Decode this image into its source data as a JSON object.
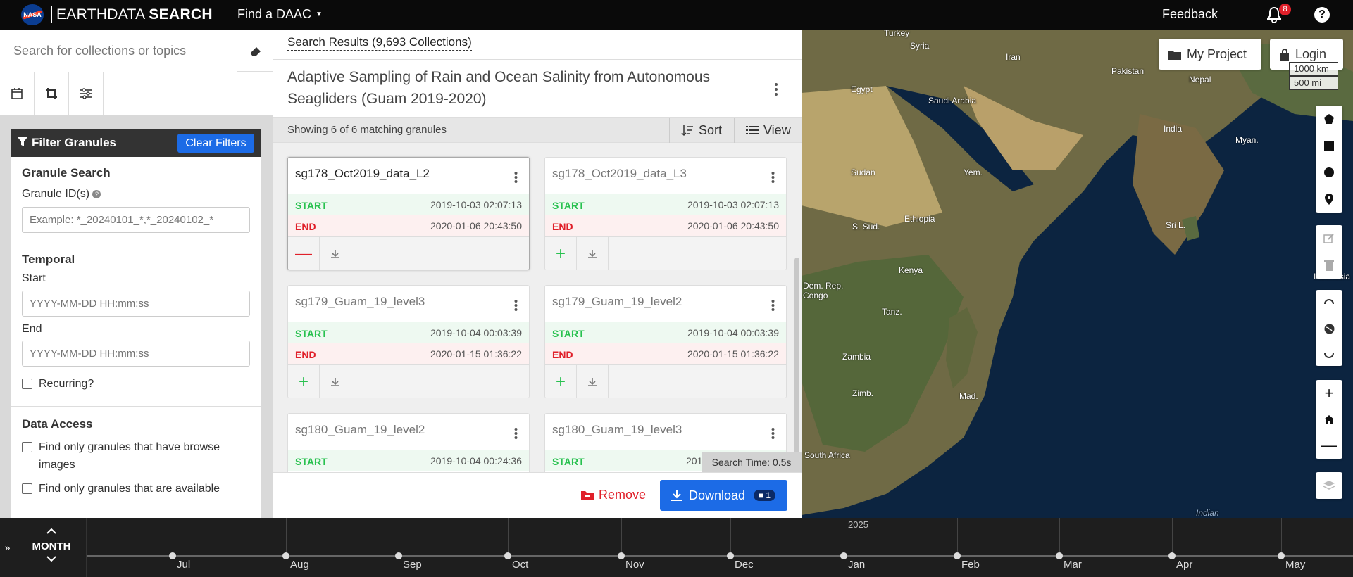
{
  "header": {
    "logo": "NASA",
    "brand_a": "EARTHDATA",
    "brand_b": "SEARCH",
    "daac_menu": "Find a DAAC",
    "feedback": "Feedback",
    "notification_count": "8",
    "help": "?"
  },
  "sidebar": {
    "search_placeholder": "Search for collections or topics",
    "icons": [
      "calendar-icon",
      "crop-icon",
      "sliders-icon"
    ],
    "filter_title": "Filter Granules",
    "clear_filters": "Clear Filters",
    "granule_search_title": "Granule Search",
    "granule_ids_label": "Granule ID(s)",
    "granule_ids_placeholder": "Example: *_20240101_*,*_20240102_*",
    "temporal_title": "Temporal",
    "start_label": "Start",
    "start_placeholder": "YYYY-MM-DD HH:mm:ss",
    "end_label": "End",
    "end_placeholder": "YYYY-MM-DD HH:mm:ss",
    "recurring_label": "Recurring?",
    "data_access_title": "Data Access",
    "browse_label": "Find only granules that have browse images",
    "available_label": "Find only granules that are available"
  },
  "results": {
    "tab": "Search Results (9,693 Collections)",
    "collection_title": "Adaptive Sampling of Rain and Ocean Salinity from Autonomous Seagliders (Guam 2019-2020)",
    "showing": "Showing 6 of 6 matching granules",
    "sort": "Sort",
    "view": "View",
    "start_word": "START",
    "end_word": "END",
    "granules": [
      {
        "name": "sg178_Oct2019_data_L2",
        "start": "2019-10-03 02:07:13",
        "end": "2020-01-06 20:43:50",
        "action": "remove"
      },
      {
        "name": "sg178_Oct2019_data_L3",
        "start": "2019-10-03 02:07:13",
        "end": "2020-01-06 20:43:50",
        "action": "add"
      },
      {
        "name": "sg179_Guam_19_level3",
        "start": "2019-10-04 00:03:39",
        "end": "2020-01-15 01:36:22",
        "action": "add"
      },
      {
        "name": "sg179_Guam_19_level2",
        "start": "2019-10-04 00:03:39",
        "end": "2020-01-15 01:36:22",
        "action": "add"
      },
      {
        "name": "sg180_Guam_19_level2",
        "start": "2019-10-04 00:24:36",
        "end": "",
        "action": "add"
      },
      {
        "name": "sg180_Guam_19_level3",
        "start": "201",
        "end": "",
        "action": "add"
      }
    ],
    "search_time": "Search Time: 0.5s",
    "remove": "Remove",
    "download": "Download",
    "download_badge": "1"
  },
  "map": {
    "my_project": "My Project",
    "login": "Login",
    "scale_km": "1000 km",
    "scale_mi": "500 mi",
    "labels": [
      "Turkey",
      "Syria",
      "Iran",
      "Pakistan",
      "Nepal",
      "Egypt",
      "Saudi Arabia",
      "India",
      "Myan.",
      "Sudan",
      "Yem.",
      "Ethiopia",
      "S. Sud.",
      "Sri L.",
      "Kenya",
      "Dem. Rep. Congo",
      "Tanz.",
      "Indonesia",
      "Zambia",
      "Zimb.",
      "Mad.",
      "South Africa",
      "Indian"
    ],
    "colors": {
      "land": "#6f6a45",
      "ocean": "#0c2440"
    }
  },
  "timeline": {
    "zoom_label": "MONTH",
    "year": "2025",
    "months": [
      "Jul",
      "Aug",
      "Sep",
      "Oct",
      "Nov",
      "Dec",
      "Jan",
      "Feb",
      "Mar",
      "Apr",
      "May"
    ]
  }
}
